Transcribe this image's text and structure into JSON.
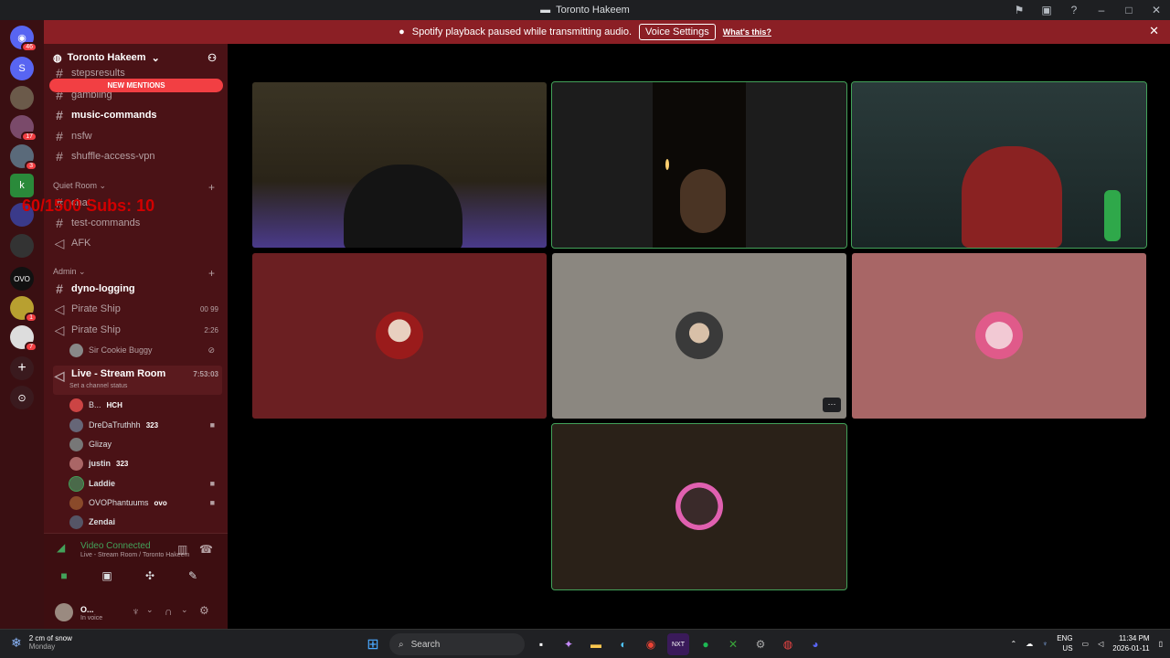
{
  "titlebar": {
    "title": "Toronto Hakeem"
  },
  "notice": {
    "message": "Spotify playback paused while transmitting audio.",
    "voice_settings_label": "Voice Settings",
    "whats_this_label": "What's this?"
  },
  "guilds": {
    "home_badge": "46",
    "badges": [
      "17",
      "3",
      "1",
      "7"
    ]
  },
  "overlay": {
    "text": "60/1500  Subs: 10"
  },
  "server": {
    "name": "Toronto Hakeem",
    "new_mentions": "NEW MENTIONS",
    "channels_top": [
      {
        "name": "stepsresults"
      },
      {
        "name": "gambling"
      },
      {
        "name": "music-commands"
      },
      {
        "name": "nsfw"
      },
      {
        "name": "shuffle-access-vpn"
      }
    ],
    "quiet_room_label": "Quiet Room",
    "quiet_channels": [
      {
        "name": "chat"
      },
      {
        "name": "test-commands"
      },
      {
        "name": "AFK"
      }
    ],
    "admin_label": "Admin",
    "admin_channels": [
      {
        "name": "dyno-logging"
      },
      {
        "name": "Pirate Ship",
        "meta": "00  99"
      },
      {
        "name": "Pirate Ship",
        "meta": "2:26"
      }
    ],
    "pirate_user": "Sir Cookie Buggy",
    "stream_room": {
      "name": "Live - Stream Room",
      "time": "7:53:03",
      "status": "Set a channel status"
    },
    "stream_users": [
      {
        "name": "B...",
        "tag": "HCH"
      },
      {
        "name": "DreDaTruthhh",
        "tag": "323"
      },
      {
        "name": "Glizay",
        "tag": ""
      },
      {
        "name": "justin",
        "tag": "323"
      },
      {
        "name": "Laddie",
        "tag": ""
      },
      {
        "name": "OVOPhantuums",
        "tag": "ovo"
      },
      {
        "name": "Zendai",
        "tag": ""
      }
    ]
  },
  "voice": {
    "title": "Video Connected",
    "subtitle": "Live - Stream Room / Toronto Hakeem"
  },
  "self": {
    "name": "O...",
    "status": "In voice"
  },
  "colors": {
    "accent_red": "#8b1f25",
    "speaking_green": "#43a25a"
  },
  "taskbar": {
    "weather_temp": "2 cm of snow",
    "weather_day": "Monday",
    "search_placeholder": "Search",
    "lang": "ENG",
    "region": "US",
    "time": "11:34 PM",
    "date": "2026-01-11"
  }
}
